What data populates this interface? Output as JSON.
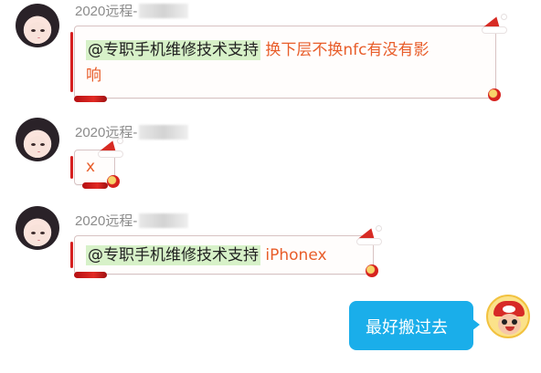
{
  "messages": [
    {
      "sender": "2020远程-",
      "mention": "@专职手机维修技术支持",
      "text_line1": "换下层不换nfc有没有影",
      "text_line2": "响"
    },
    {
      "sender": "2020远程-",
      "text": "x"
    },
    {
      "sender": "2020远程-",
      "mention": "@专职手机维修技术支持",
      "text": "iPhonex"
    }
  ],
  "my_message": {
    "text": "最好搬过去"
  },
  "colors": {
    "mention_bg": "#d7f1c8",
    "orange_text": "#e85d2a",
    "blue_bubble": "#1aaeea",
    "sender_gray": "#8b8b8b"
  },
  "icons": {
    "avatar_left": "girl-avatar-icon",
    "avatar_right": "cartoon-cap-avatar-icon",
    "decoration": "santa-hat-icon"
  }
}
